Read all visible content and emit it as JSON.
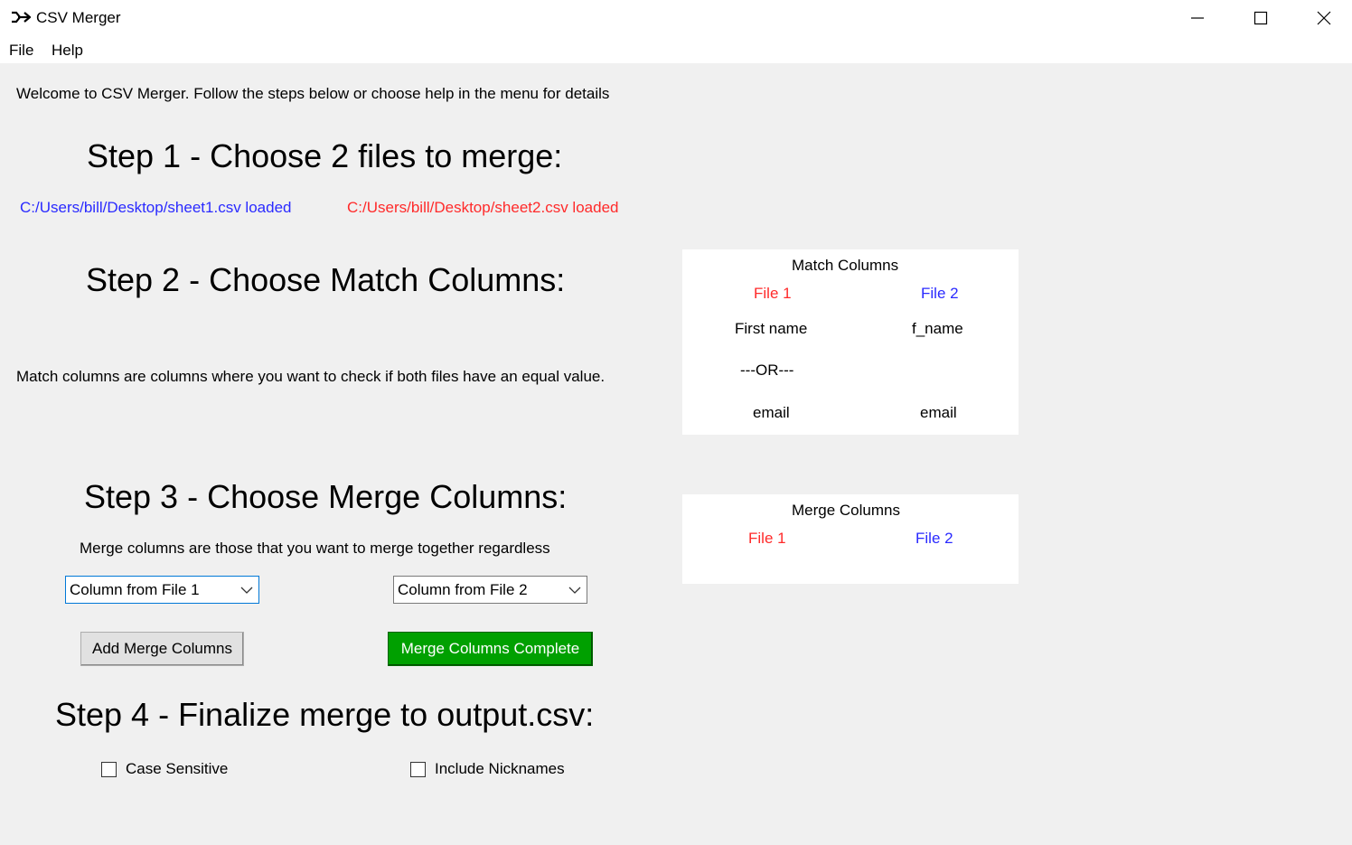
{
  "window": {
    "title": "CSV Merger",
    "controls": [
      "minimize",
      "maximize",
      "close"
    ]
  },
  "menu": {
    "items": [
      "File",
      "Help"
    ]
  },
  "welcome": "Welcome to CSV Merger. Follow the steps below or choose help in the menu for details",
  "step1": {
    "heading": "Step 1 - Choose 2 files to merge:",
    "file1_status": "C:/Users/bill/Desktop/sheet1.csv loaded",
    "file2_status": "C:/Users/bill/Desktop/sheet2.csv loaded"
  },
  "step2": {
    "heading": "Step 2 - Choose Match Columns:",
    "description": "Match columns are columns where you want to check if both files have an equal value."
  },
  "match_panel": {
    "title": "Match Columns",
    "file1_label": "File 1",
    "file2_label": "File 2",
    "rows": [
      {
        "file1": "First name",
        "file2": "f_name"
      },
      {
        "separator": "---OR---"
      },
      {
        "file1": "email",
        "file2": "email"
      }
    ]
  },
  "step3": {
    "heading": "Step 3 - Choose Merge Columns:",
    "description": "Merge columns are those that you want to merge together regardless",
    "combo1_value": "Column from File 1",
    "combo2_value": "Column from File 2",
    "add_button": "Add Merge Columns",
    "complete_button": "Merge Columns Complete"
  },
  "merge_panel": {
    "title": "Merge Columns",
    "file1_label": "File 1",
    "file2_label": "File 2"
  },
  "step4": {
    "heading": "Step 4 - Finalize merge to output.csv:",
    "case_sensitive_label": "Case Sensitive",
    "include_nicknames_label": "Include Nicknames"
  },
  "colors": {
    "file1_blue": "#2a2aff",
    "file2_red": "#ff2a2a",
    "complete_green": "#00a000",
    "background": "#f0f0f0"
  }
}
